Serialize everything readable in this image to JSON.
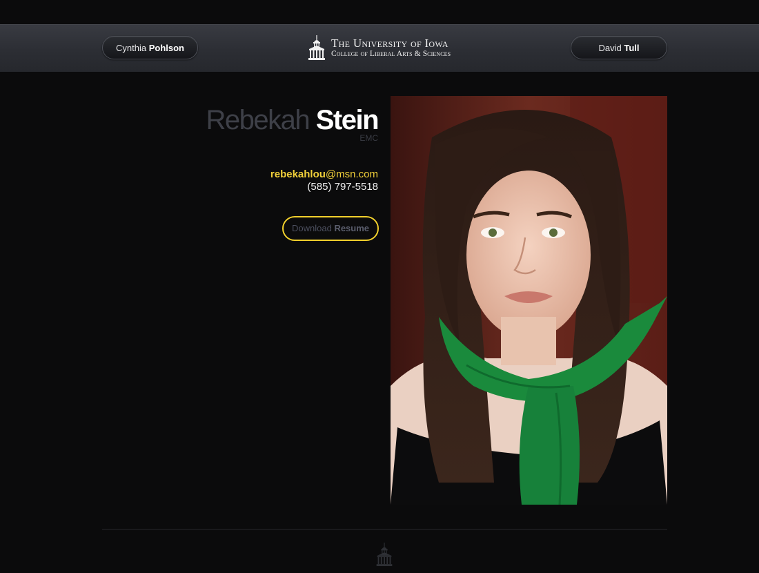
{
  "nav": {
    "prev": {
      "first": "Cynthia",
      "last": "Pohlson"
    },
    "next": {
      "first": "David",
      "last": "Tull"
    }
  },
  "logo": {
    "line1": "The University of Iowa",
    "line2": "College of Liberal Arts & Sciences",
    "icon": "old-capitol-dome-icon"
  },
  "profile": {
    "first_name": "Rebekah",
    "last_name": "Stein",
    "degree": "EMC",
    "email_user": "rebekahlou",
    "email_domain": "@msn.com",
    "phone": "(585) 797-5518",
    "resume_prefix": "Download",
    "resume_suffix": "Resume"
  },
  "colors": {
    "accent": "#f1d02c",
    "background": "#0b0b0c",
    "header": "#2f3137"
  }
}
